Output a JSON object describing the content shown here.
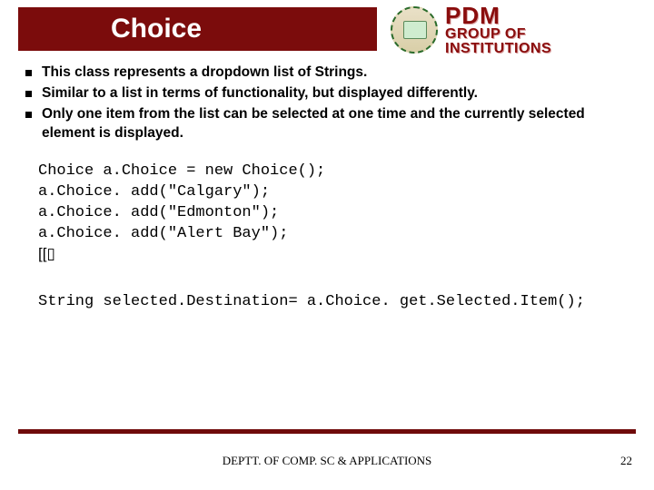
{
  "title": "Choice",
  "logo": {
    "line1": "PDM",
    "line2": "GROUP OF",
    "line3": "INSTITUTIONS"
  },
  "bullets": [
    "This class represents a dropdown list of Strings.",
    "Similar to a list in terms of functionality, but displayed differently.",
    "Only one item from the list can be selected at one time and the currently selected element is displayed."
  ],
  "code1": [
    "Choice a.Choice = new Choice();",
    "a.Choice. add(\"Calgary\");",
    "a.Choice. add(\"Edmonton\");",
    "a.Choice. add(\"Alert Bay\");",
    "[[▯"
  ],
  "code2": "String selected.Destination= a.Choice. get.Selected.Item();",
  "footer": {
    "dept": "DEPTT. OF COMP. SC & APPLICATIONS",
    "page": "22"
  }
}
